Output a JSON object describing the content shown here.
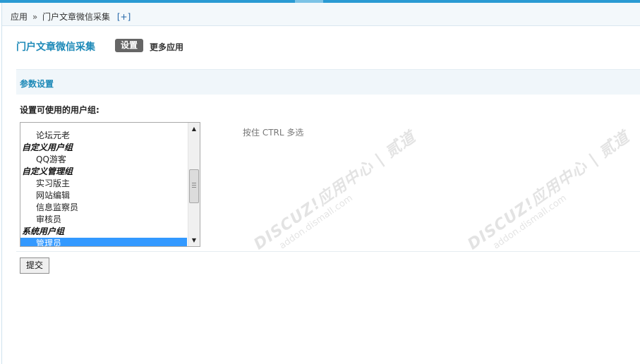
{
  "breadcrumb": {
    "root": "应用",
    "separator": "»",
    "current": "门户文章微信采集",
    "plus": "[+]"
  },
  "header": {
    "title": "门户文章微信采集",
    "tab_active": "设置",
    "tab_more": "更多应用"
  },
  "section": {
    "title": "参数设置"
  },
  "setting": {
    "label": "设置可使用的用户组:",
    "hint": "按住 CTRL 多选",
    "list": [
      {
        "type": "option",
        "text": ""
      },
      {
        "type": "option",
        "text": "论坛元老"
      },
      {
        "type": "group",
        "text": "自定义用户组"
      },
      {
        "type": "option",
        "text": "QQ游客"
      },
      {
        "type": "group",
        "text": "自定义管理组"
      },
      {
        "type": "option",
        "text": "实习版主"
      },
      {
        "type": "option",
        "text": "网站编辑"
      },
      {
        "type": "option",
        "text": "信息监察员"
      },
      {
        "type": "option",
        "text": "审核员"
      },
      {
        "type": "group",
        "text": "系统用户组"
      },
      {
        "type": "option",
        "text": "管理员",
        "selected": true
      }
    ]
  },
  "submit": {
    "label": "提交"
  },
  "watermark": {
    "brand": "DISCUZ!应用中心 | 贰道",
    "url": "addon.dismall.com"
  },
  "colors": {
    "accent": "#1e8ab8",
    "topbar": "#2a9ad3",
    "selected": "#3399ff"
  }
}
